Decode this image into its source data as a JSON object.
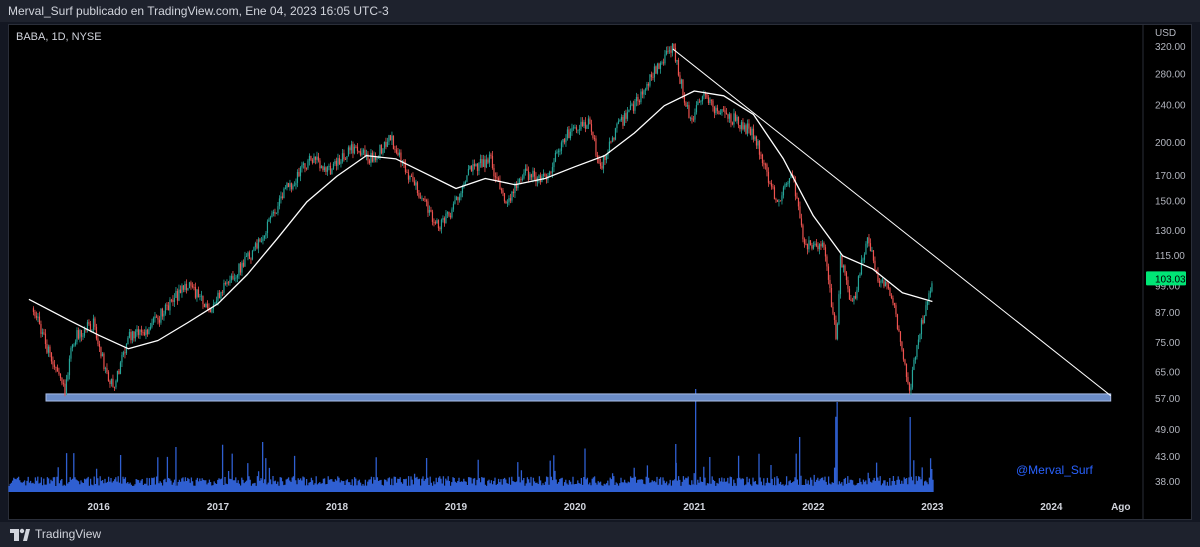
{
  "header": {
    "publish_line": "Merval_Surf publicado en TradingView.com, Ene 04, 2023 16:05 UTC-3"
  },
  "chart": {
    "symbol_line": "BABA, 1D, NYSE",
    "currency": "USD",
    "last_price_label": "103.03",
    "watermark": "@Merval_Surf"
  },
  "footer": {
    "brand": "TradingView"
  },
  "colors": {
    "up": "#26a69a",
    "down": "#ef5350",
    "ma": "#ffffff",
    "trendline": "#ffffff",
    "support_zone": "#6b8cc7",
    "volume": "#2f5fd1",
    "price_badge": "#00e676",
    "watermark": "#2962ff",
    "background": "#000000"
  },
  "chart_data": {
    "type": "candlestick",
    "log_scale": true,
    "y_ticks": [
      "320.00",
      "280.00",
      "240.00",
      "200.00",
      "170.00",
      "150.00",
      "130.00",
      "115.00",
      "99.00",
      "87.00",
      "75.00",
      "65.00",
      "57.00",
      "49.00",
      "43.00",
      "38.00"
    ],
    "x_ticks": [
      "2016",
      "2017",
      "2018",
      "2019",
      "2020",
      "2021",
      "2022",
      "2023",
      "2024",
      "Ago"
    ],
    "series": [
      {
        "name": "price",
        "points": [
          [
            "2015-06-15",
            89
          ],
          [
            "2015-08-20",
            66
          ],
          [
            "2015-09-20",
            59
          ],
          [
            "2015-10-10",
            76
          ],
          [
            "2015-12-15",
            83
          ],
          [
            "2016-01-10",
            70
          ],
          [
            "2016-02-15",
            60
          ],
          [
            "2016-04-01",
            78
          ],
          [
            "2016-06-01",
            80
          ],
          [
            "2016-08-01",
            90
          ],
          [
            "2016-10-01",
            101
          ],
          [
            "2016-12-01",
            88
          ],
          [
            "2017-02-15",
            104
          ],
          [
            "2017-05-01",
            120
          ],
          [
            "2017-06-15",
            140
          ],
          [
            "2017-08-01",
            160
          ],
          [
            "2017-10-15",
            185
          ],
          [
            "2017-12-15",
            175
          ],
          [
            "2018-02-15",
            195
          ],
          [
            "2018-04-15",
            185
          ],
          [
            "2018-06-15",
            205
          ],
          [
            "2018-08-01",
            172
          ],
          [
            "2018-10-01",
            150
          ],
          [
            "2018-10-30",
            133
          ],
          [
            "2018-12-15",
            140
          ],
          [
            "2019-02-01",
            172
          ],
          [
            "2019-04-15",
            185
          ],
          [
            "2019-06-01",
            150
          ],
          [
            "2019-08-01",
            172
          ],
          [
            "2019-10-01",
            168
          ],
          [
            "2019-12-15",
            212
          ],
          [
            "2020-02-15",
            220
          ],
          [
            "2020-03-18",
            176
          ],
          [
            "2020-05-01",
            210
          ],
          [
            "2020-07-15",
            250
          ],
          [
            "2020-09-01",
            285
          ],
          [
            "2020-10-27",
            317
          ],
          [
            "2020-11-15",
            280
          ],
          [
            "2020-12-20",
            222
          ],
          [
            "2021-01-25",
            255
          ],
          [
            "2021-03-15",
            232
          ],
          [
            "2021-05-01",
            225
          ],
          [
            "2021-07-01",
            210
          ],
          [
            "2021-08-20",
            165
          ],
          [
            "2021-09-15",
            150
          ],
          [
            "2021-10-25",
            175
          ],
          [
            "2021-12-01",
            125
          ],
          [
            "2022-01-01",
            118
          ],
          [
            "2022-02-01",
            122
          ],
          [
            "2022-03-14",
            75
          ],
          [
            "2022-03-25",
            115
          ],
          [
            "2022-05-01",
            90
          ],
          [
            "2022-06-15",
            125
          ],
          [
            "2022-07-15",
            105
          ],
          [
            "2022-09-01",
            95
          ],
          [
            "2022-10-24",
            58
          ],
          [
            "2022-11-15",
            76
          ],
          [
            "2022-12-15",
            90
          ],
          [
            "2023-01-04",
            103
          ]
        ]
      },
      {
        "name": "moving average",
        "points": [
          [
            "2015-06-01",
            93
          ],
          [
            "2015-10-01",
            84
          ],
          [
            "2016-01-01",
            78
          ],
          [
            "2016-04-01",
            73
          ],
          [
            "2016-07-01",
            76
          ],
          [
            "2016-10-01",
            83
          ],
          [
            "2017-01-01",
            91
          ],
          [
            "2017-04-01",
            105
          ],
          [
            "2017-07-01",
            125
          ],
          [
            "2017-10-01",
            150
          ],
          [
            "2018-01-01",
            170
          ],
          [
            "2018-04-01",
            188
          ],
          [
            "2018-07-01",
            185
          ],
          [
            "2018-10-01",
            172
          ],
          [
            "2019-01-01",
            160
          ],
          [
            "2019-04-01",
            168
          ],
          [
            "2019-07-01",
            163
          ],
          [
            "2019-10-01",
            168
          ],
          [
            "2020-01-01",
            178
          ],
          [
            "2020-04-01",
            188
          ],
          [
            "2020-07-01",
            210
          ],
          [
            "2020-10-01",
            240
          ],
          [
            "2021-01-01",
            258
          ],
          [
            "2021-04-01",
            252
          ],
          [
            "2021-07-01",
            230
          ],
          [
            "2021-10-01",
            185
          ],
          [
            "2022-01-01",
            140
          ],
          [
            "2022-04-01",
            115
          ],
          [
            "2022-07-01",
            108
          ],
          [
            "2022-10-01",
            96
          ],
          [
            "2023-01-01",
            92
          ]
        ]
      },
      {
        "name": "trendline",
        "points": [
          [
            "2020-10-27",
            317
          ],
          [
            "2024-07-01",
            58
          ]
        ]
      },
      {
        "name": "support zone",
        "range": [
          56.5,
          58.5
        ],
        "from": "2015-06-01",
        "to": "2024-07-01"
      }
    ]
  }
}
